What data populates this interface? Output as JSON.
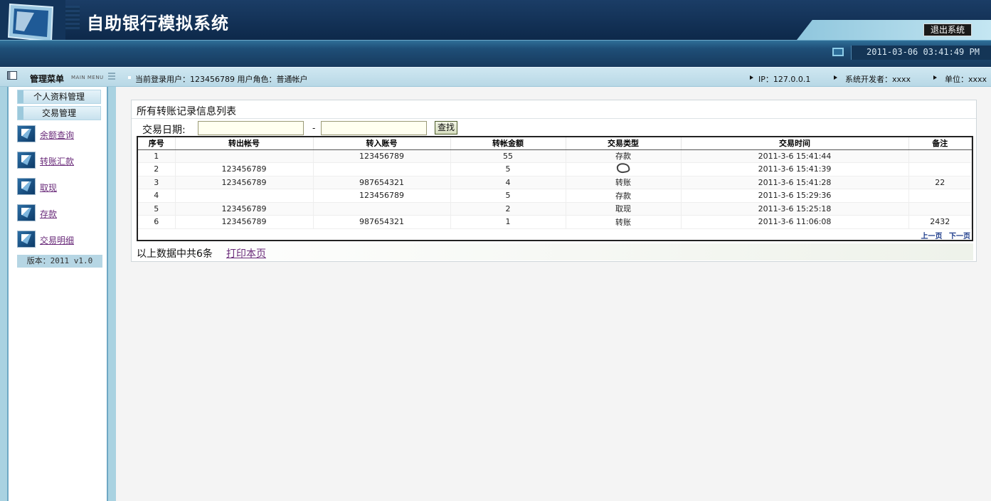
{
  "app": {
    "title": "自助银行模拟系统",
    "exit_label": "退出系统",
    "datetime": "2011-03-06 03:41:49 PM"
  },
  "menubar": {
    "title": "管理菜单",
    "subtitle": "MAIN MENU",
    "user_info": "当前登录用户：123456789   用户角色：普通帐户",
    "ip": "IP：127.0.0.1",
    "developer": "系统开发者：xxxx",
    "unit": "单位：xxxx"
  },
  "sidebar": {
    "sections": [
      "个人资料管理",
      "交易管理"
    ],
    "items": [
      {
        "label": "余额查询",
        "icon": "atm-icon"
      },
      {
        "label": "转账汇款",
        "icon": "atm-icon"
      },
      {
        "label": "取现",
        "icon": "atm-icon"
      },
      {
        "label": "存款",
        "icon": "atm-icon"
      },
      {
        "label": "交易明细",
        "icon": "atm-icon"
      }
    ],
    "version": "版本：2011 v1.0"
  },
  "main": {
    "panel_title": "所有转账记录信息列表",
    "date_label": "交易日期:",
    "date_from": "",
    "date_to": "",
    "dash": "-",
    "search_label": "查找",
    "columns": [
      "序号",
      "转出帐号",
      "转入账号",
      "转帐金额",
      "交易类型",
      "交易时间",
      "备注"
    ],
    "rows": [
      [
        "1",
        "",
        "123456789",
        "55",
        "存款",
        "2011-3-6 15:41:44",
        ""
      ],
      [
        "2",
        "123456789",
        "",
        "5",
        "",
        "2011-3-6 15:41:39",
        ""
      ],
      [
        "3",
        "123456789",
        "987654321",
        "4",
        "转账",
        "2011-3-6 15:41:28",
        "22"
      ],
      [
        "4",
        "",
        "123456789",
        "5",
        "存款",
        "2011-3-6 15:29:36",
        ""
      ],
      [
        "5",
        "123456789",
        "",
        "2",
        "取现",
        "2011-3-6 15:25:18",
        ""
      ],
      [
        "6",
        "123456789",
        "987654321",
        "1",
        "转账",
        "2011-3-6 11:06:08",
        "2432"
      ]
    ],
    "pager_prev": "上一页",
    "pager_next": "下一页",
    "summary": "以上数据中共6条",
    "print_label": "打印本页"
  },
  "colors": {
    "header_bg": "#0e2a4c",
    "menubar_bg": "#c4e0ec",
    "link": "#6a2b7a",
    "pager": "#1c3b8a"
  }
}
